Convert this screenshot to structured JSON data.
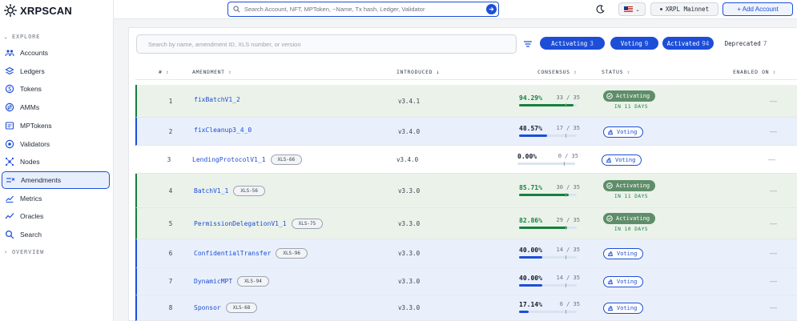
{
  "brand": {
    "name": "XRPSCAN"
  },
  "sidebar": {
    "explore_label": "EXPLORE",
    "overview_label": "OVERVIEW",
    "items": [
      {
        "label": "Accounts",
        "icon": "users-icon",
        "active": false
      },
      {
        "label": "Ledgers",
        "icon": "layers-icon",
        "active": false
      },
      {
        "label": "Tokens",
        "icon": "coin-icon",
        "active": false
      },
      {
        "label": "AMMs",
        "icon": "swap-coins-icon",
        "active": false
      },
      {
        "label": "MPTokens",
        "icon": "token-box-icon",
        "active": false
      },
      {
        "label": "Validators",
        "icon": "validator-icon",
        "active": false
      },
      {
        "label": "Nodes",
        "icon": "network-icon",
        "active": false
      },
      {
        "label": "Amendments",
        "icon": "amendment-icon",
        "active": true
      },
      {
        "label": "Metrics",
        "icon": "chart-icon",
        "active": false
      },
      {
        "label": "Oracles",
        "icon": "trend-icon",
        "active": false
      },
      {
        "label": "Search",
        "icon": "search-icon",
        "active": false
      }
    ]
  },
  "header": {
    "search_placeholder": "Search Account, NFT, MPToken, ~Name, Tx hash, Ledger, Validator",
    "network": "XRPL Mainnet",
    "add_account": "+ Add Account"
  },
  "filters": {
    "placeholder": "Search by name, amendment ID, XLS number, or version",
    "chips": [
      {
        "label": "Activating",
        "count": "3"
      },
      {
        "label": "Voting",
        "count": "9"
      },
      {
        "label": "Activated",
        "count": "94"
      },
      {
        "label": "Deprecated",
        "count": "7"
      }
    ]
  },
  "table": {
    "columns": {
      "num": "#",
      "amendment": "AMENDMENT",
      "introduced": "INTRODUCED",
      "consensus": "CONSENSUS",
      "status": "STATUS",
      "enabled_on": "ENABLED ON"
    },
    "rows": [
      {
        "num": "1",
        "name": "fixBatchV1_2",
        "xls": "",
        "introduced": "v3.4.1",
        "pct": "94.29%",
        "votes": "33 / 35",
        "fraction": 0.9429,
        "status": "Activating",
        "days": "IN 11 DAYS",
        "enabled": "—"
      },
      {
        "num": "2",
        "name": "fixCleanup3_4_0",
        "xls": "",
        "introduced": "v3.4.0",
        "pct": "48.57%",
        "votes": "17 / 35",
        "fraction": 0.4857,
        "status": "Voting",
        "days": "",
        "enabled": "—"
      },
      {
        "num": "3",
        "name": "LendingProtocolV1_1",
        "xls": "XLS-66",
        "introduced": "v3.4.0",
        "pct": "0.00%",
        "votes": "0 / 35",
        "fraction": 0.0,
        "status": "Voting",
        "days": "",
        "enabled": "—"
      },
      {
        "num": "4",
        "name": "BatchV1_1",
        "xls": "XLS-56",
        "introduced": "v3.3.0",
        "pct": "85.71%",
        "votes": "30 / 35",
        "fraction": 0.8571,
        "status": "Activating",
        "days": "IN 11 DAYS",
        "enabled": "—"
      },
      {
        "num": "5",
        "name": "PermissionDelegationV1_1",
        "xls": "XLS-75",
        "introduced": "v3.3.0",
        "pct": "82.86%",
        "votes": "29 / 35",
        "fraction": 0.8286,
        "status": "Activating",
        "days": "IN 10 DAYS",
        "enabled": "—"
      },
      {
        "num": "6",
        "name": "ConfidentialTransfer",
        "xls": "XLS-96",
        "introduced": "v3.3.0",
        "pct": "40.00%",
        "votes": "14 / 35",
        "fraction": 0.4,
        "status": "Voting",
        "days": "",
        "enabled": "—"
      },
      {
        "num": "7",
        "name": "DynamicMPT",
        "xls": "XLS-94",
        "introduced": "v3.3.0",
        "pct": "40.00%",
        "votes": "14 / 35",
        "fraction": 0.4,
        "status": "Voting",
        "days": "",
        "enabled": "—"
      },
      {
        "num": "8",
        "name": "Sponsor",
        "xls": "XLS-68",
        "introduced": "v3.3.0",
        "pct": "17.14%",
        "votes": "6 / 35",
        "fraction": 0.1714,
        "status": "Voting",
        "days": "",
        "enabled": "—"
      }
    ]
  },
  "colors": {
    "accent": "#1d4ed8",
    "activating": "#15803d",
    "activating_row": "#ebf2ea",
    "voting_row": "#eaf0fb"
  }
}
